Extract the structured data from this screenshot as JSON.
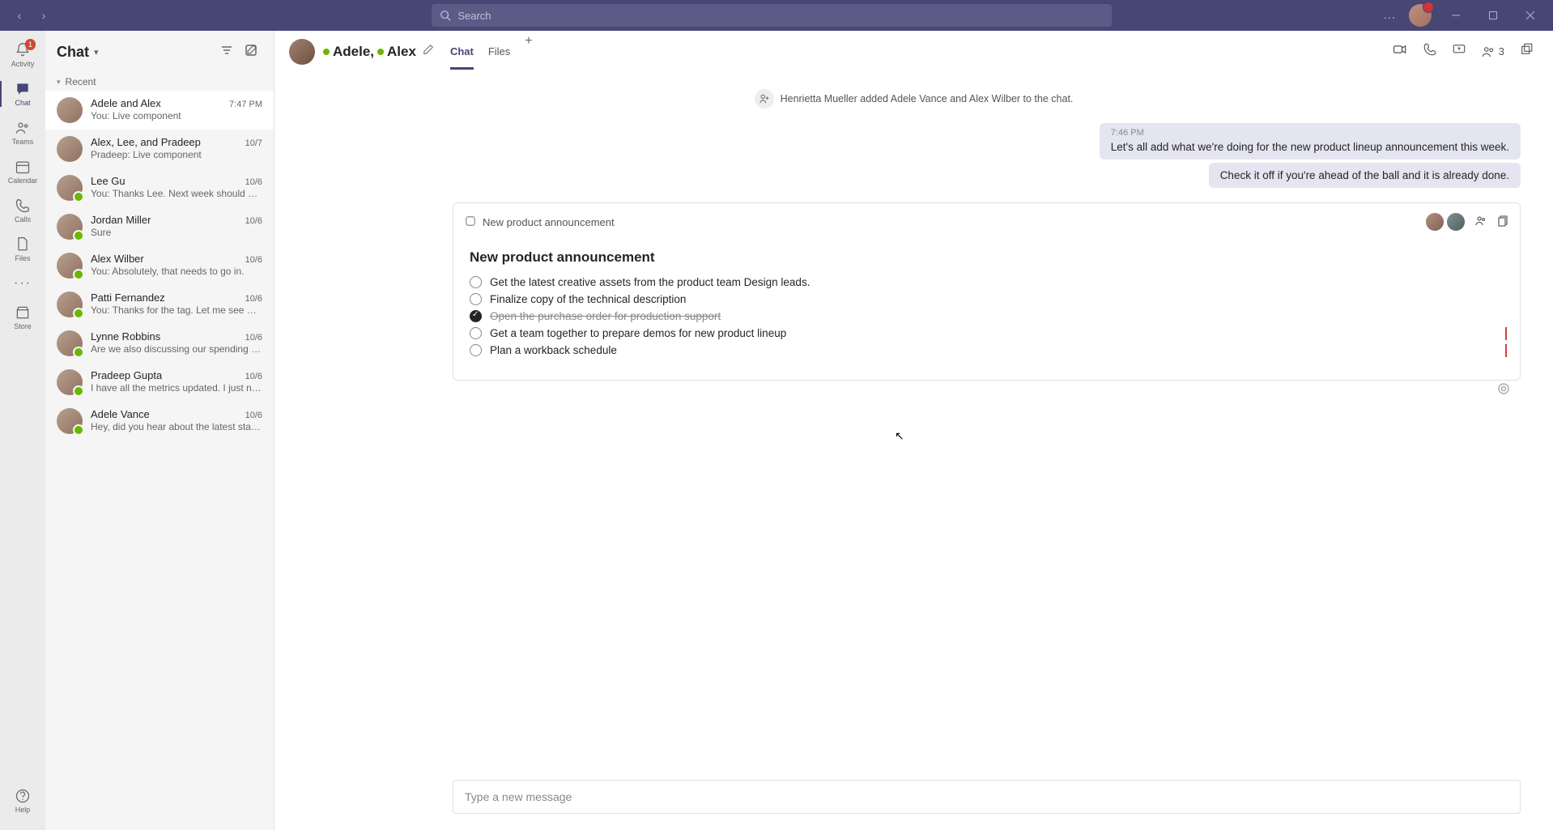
{
  "titlebar": {
    "search_placeholder": "Search",
    "more": "…"
  },
  "rail": {
    "activity": "Activity",
    "activity_badge": "1",
    "chat": "Chat",
    "teams": "Teams",
    "calendar": "Calendar",
    "calls": "Calls",
    "files": "Files",
    "store": "Store",
    "help": "Help"
  },
  "chat_pane": {
    "title": "Chat",
    "section_recent": "Recent",
    "items": [
      {
        "name": "Adele and Alex",
        "preview": "You: Live component",
        "time": "7:47 PM",
        "selected": true
      },
      {
        "name": "Alex, Lee, and Pradeep",
        "preview": "Pradeep: Live component",
        "time": "10/7"
      },
      {
        "name": "Lee Gu",
        "preview": "You: Thanks Lee. Next week should work. Let's br…",
        "time": "10/6"
      },
      {
        "name": "Jordan Miller",
        "preview": "Sure",
        "time": "10/6"
      },
      {
        "name": "Alex Wilber",
        "preview": "You: Absolutely, that needs to go in.",
        "time": "10/6"
      },
      {
        "name": "Patti Fernandez",
        "preview": "You: Thanks for the tag. Let me see what I can co…",
        "time": "10/6"
      },
      {
        "name": "Lynne Robbins",
        "preview": "Are we also discussing our spending metrics?",
        "time": "10/6"
      },
      {
        "name": "Pradeep Gupta",
        "preview": "I have all the metrics updated. I just need the tea…",
        "time": "10/6"
      },
      {
        "name": "Adele Vance",
        "preview": "Hey, did you hear about the latest status?",
        "time": "10/6"
      }
    ]
  },
  "conversation": {
    "title_parts": [
      "Adele,",
      "Alex"
    ],
    "tabs": {
      "chat": "Chat",
      "files": "Files"
    },
    "participant_count": "3",
    "system_message": "Henrietta Mueller added Adele Vance and Alex Wilber to the chat.",
    "msg_time": "7:46 PM",
    "messages": [
      "Let's all add what we're doing for the new product lineup announcement this week.",
      "Check it off if you're ahead of the ball and it is already done."
    ],
    "component": {
      "bar_title": "New product announcement",
      "heading": "New product announcement",
      "tasks": [
        {
          "text": "Get the latest creative assets from the product team Design leads.",
          "checked": false
        },
        {
          "text": "Finalize copy of the technical description",
          "checked": false
        },
        {
          "text": "Open the purchase order for production support",
          "checked": true
        },
        {
          "text": "Get a team together to prepare demos for new product lineup",
          "checked": false,
          "caret": true
        },
        {
          "text": "Plan a workback schedule",
          "checked": false,
          "caret": true
        }
      ]
    },
    "compose_placeholder": "Type a new message"
  }
}
